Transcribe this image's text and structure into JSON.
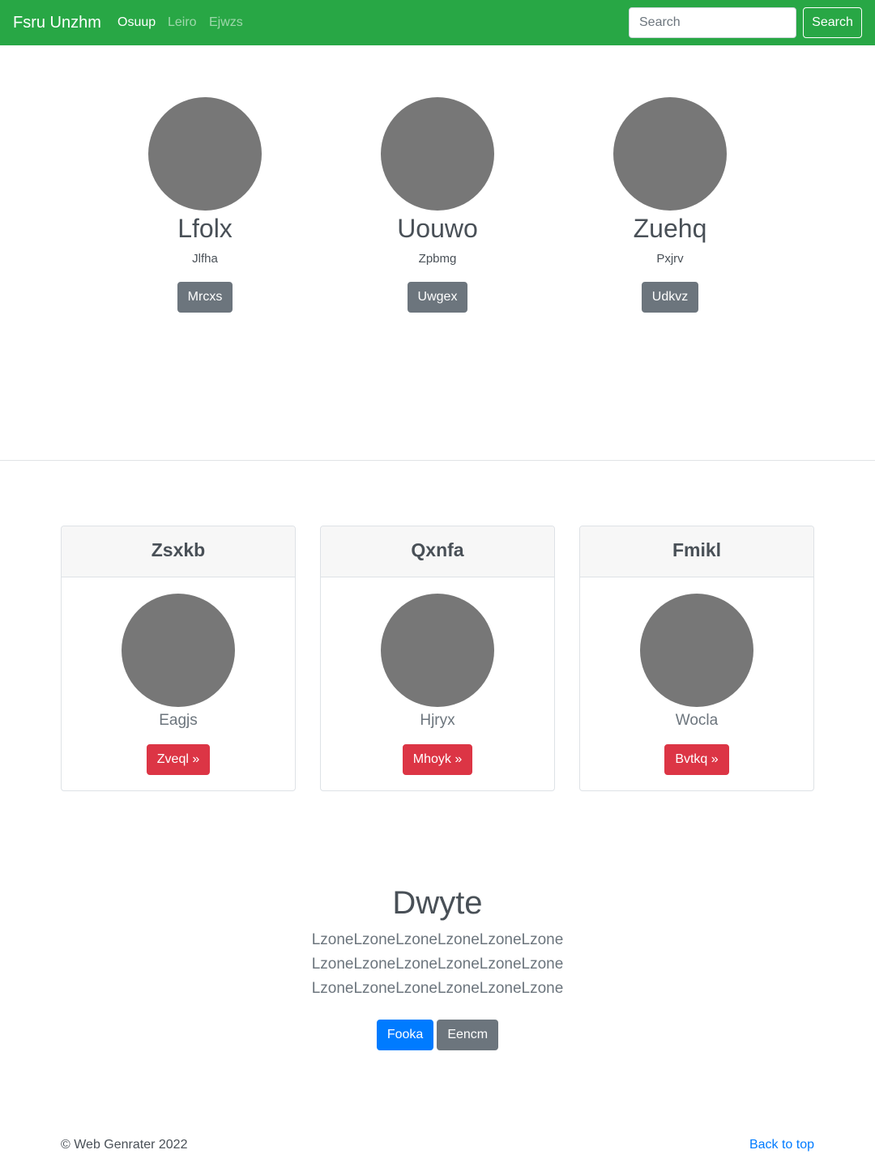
{
  "navbar": {
    "brand": "Fsru Unzhm",
    "links": [
      {
        "label": "Osuup",
        "active": true
      },
      {
        "label": "Leiro",
        "active": false
      },
      {
        "label": "Ejwzs",
        "active": false
      }
    ],
    "search": {
      "placeholder": "Search",
      "value": "",
      "button_label": "Search"
    },
    "color": "#28a745"
  },
  "profiles": [
    {
      "name": "Lfolx",
      "subtitle": "Jlfha",
      "button_label": "Mrcxs"
    },
    {
      "name": "Uouwo",
      "subtitle": "Zpbmg",
      "button_label": "Uwgex"
    },
    {
      "name": "Zuehq",
      "subtitle": "Pxjrv",
      "button_label": "Udkvz"
    }
  ],
  "cards": [
    {
      "title": "Zsxkb",
      "subtitle": "Eagjs",
      "button_label": "Zveql »"
    },
    {
      "title": "Qxnfa",
      "subtitle": "Hjryx",
      "button_label": "Mhoyk »"
    },
    {
      "title": "Fmikl",
      "subtitle": "Wocla",
      "button_label": "Bvtkq »"
    }
  ],
  "hero": {
    "title": "Dwyte",
    "lines": [
      "LzoneLzoneLzoneLzoneLzoneLzone",
      "LzoneLzoneLzoneLzoneLzoneLzone",
      "LzoneLzoneLzoneLzoneLzoneLzone"
    ],
    "primary_button": "Fooka",
    "secondary_button": "Eencm"
  },
  "footer": {
    "copyright": "© Web Genrater 2022",
    "back_to_top": "Back to top"
  },
  "colors": {
    "primary": "#007bff",
    "secondary": "#6c757d",
    "danger": "#dc3545",
    "success": "#28a745",
    "avatar": "#777777"
  }
}
